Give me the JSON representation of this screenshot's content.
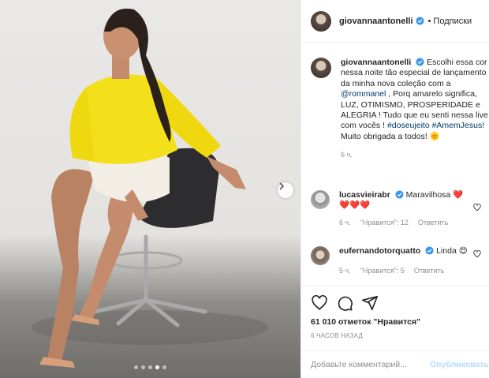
{
  "post": {
    "username": "giovannaantonelli",
    "follow_label": "• Подписки",
    "likes_text": "61 010 отметок \"Нравится\"",
    "time_ago": "6 ЧАСОВ НАЗАД",
    "add_comment_placeholder": "Добавьте комментарий...",
    "publish_label": "Опубликовать",
    "carousel": {
      "total": 5,
      "active_index": 3
    }
  },
  "caption": {
    "username": "giovannaantonelli",
    "text_1": "Escolhi essa cor nessa noite tão especial de lançamento da minha nova coleção com a",
    "mention": "@rommanel",
    "text_2": ", Porq amarelo significa, LUZ, OTIMISMO, PROSPERIDADE e ALEGRIA ! Tudo que eu senti nessa live com vocês !",
    "hashtag_1": "#doseujeito",
    "hashtag_2": "#AmemJesus",
    "text_3": "! Muito obrigada a todos!",
    "emoji": "🌞",
    "time": "6 ч."
  },
  "comments": [
    {
      "username": "lucasvieirabr",
      "text": "Maravilhosa ❤️",
      "line2": "❤️❤️❤️",
      "time": "6 ч.",
      "likes": "\"Нравится\": 12",
      "reply": "Ответить"
    },
    {
      "username": "eufernandotorquatto",
      "text": "Linda 😍",
      "time": "5 ч.",
      "likes": "\"Нравится\": 5",
      "reply": "Ответить"
    }
  ],
  "colors": {
    "verified": "#3897f0",
    "heart": "#ed4956",
    "link": "#00376b",
    "muted": "#8e8e8e"
  },
  "icons": [
    "heart-icon",
    "comment-icon",
    "share-icon",
    "verified-icon",
    "chevron-right-icon"
  ]
}
